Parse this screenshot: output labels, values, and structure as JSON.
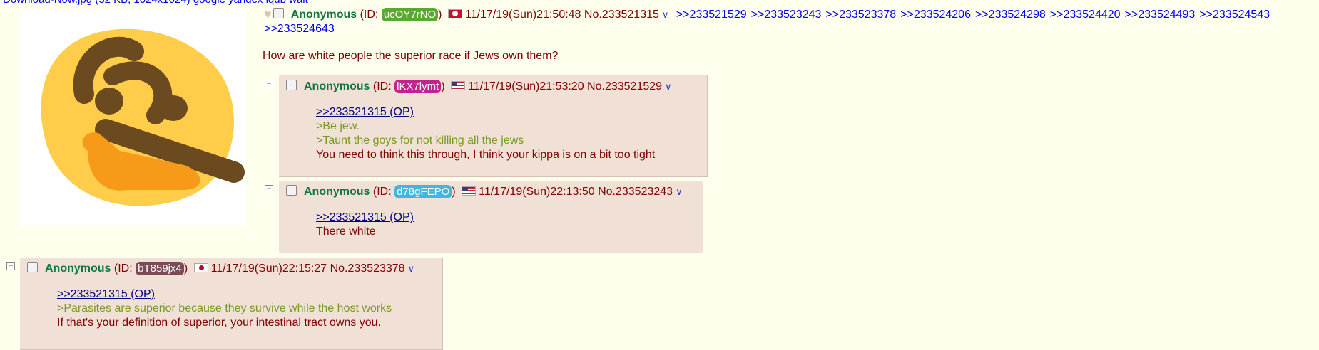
{
  "file_line": "Download-Now.jpg (32 KB, 1024x1024) google yandex iqdb wait",
  "op": {
    "name": "Anonymous",
    "id_prefix": "(ID: ",
    "id": "ucOY7rNO",
    "id_color": "#5aa82f",
    "date": "11/17/19(Sun)21:50:48",
    "no": "No.233521315",
    "backlinks": [
      ">>233521529",
      ">>233523243",
      ">>233523378",
      ">>233524206",
      ">>233524298",
      ">>233524420",
      ">>233524493",
      ">>233524543"
    ],
    "backlinks2": [
      ">>233524643"
    ],
    "message": "How are white people the superior race if Jews own them?"
  },
  "replies": [
    {
      "name": "Anonymous",
      "id_prefix": "(ID: ",
      "id": "lKX7lymt",
      "id_color": "#c2218f",
      "date": "11/17/19(Sun)21:53:20",
      "no": "No.233521529",
      "quote": ">>233521315 (OP)",
      "green": [
        ">Be jew.",
        ">Taunt the goys for not killing all the jews"
      ],
      "text": "You need to think this through, I think your kippa is on a bit too tight"
    },
    {
      "name": "Anonymous",
      "id_prefix": "(ID: ",
      "id": "d78gFEPO",
      "id_color": "#3fb6e6",
      "date": "11/17/19(Sun)22:13:50",
      "no": "No.233523243",
      "quote": ">>233521315 (OP)",
      "green": [],
      "text": "There white"
    },
    {
      "name": "Anonymous",
      "id_prefix": "(ID: ",
      "id": "bT859jx4",
      "id_color": "#7a4a55",
      "date": "11/17/19(Sun)22:15:27",
      "no": "No.233523378",
      "quote": ">>233521315 (OP)",
      "green": [
        ">Parasites are superior because they survive while the host works"
      ],
      "text": "If that's your definition of superior, your intestinal tract owns you."
    }
  ],
  "ui": {
    "hide_glyph": "−",
    "caret_glyph": "∨",
    "close_paren": ")",
    "heart_glyph": "♥"
  }
}
